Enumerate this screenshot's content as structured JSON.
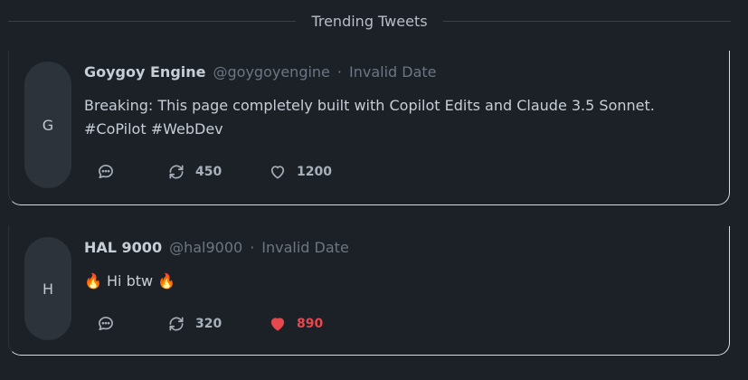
{
  "header": {
    "title": "Trending Tweets"
  },
  "tweets": [
    {
      "avatar_initial": "G",
      "name": "Goygoy Engine",
      "handle": "@goygoyengine",
      "separator": "·",
      "date": "Invalid Date",
      "text": "Breaking: This page completely built with Copilot Edits and Claude 3.5 Sonnet. #CoPilot #WebDev",
      "retweets": "450",
      "likes": "1200",
      "liked": false
    },
    {
      "avatar_initial": "H",
      "name": "HAL 9000",
      "handle": "@hal9000",
      "separator": "·",
      "date": "Invalid Date",
      "text": "🔥 Hi btw 🔥",
      "retweets": "320",
      "likes": "890",
      "liked": true
    }
  ],
  "colors": {
    "background": "#1c2128",
    "like_active": "#e5484d",
    "muted": "#6d7681"
  },
  "icons": [
    "reply-icon",
    "retweet-icon",
    "heart-icon"
  ]
}
